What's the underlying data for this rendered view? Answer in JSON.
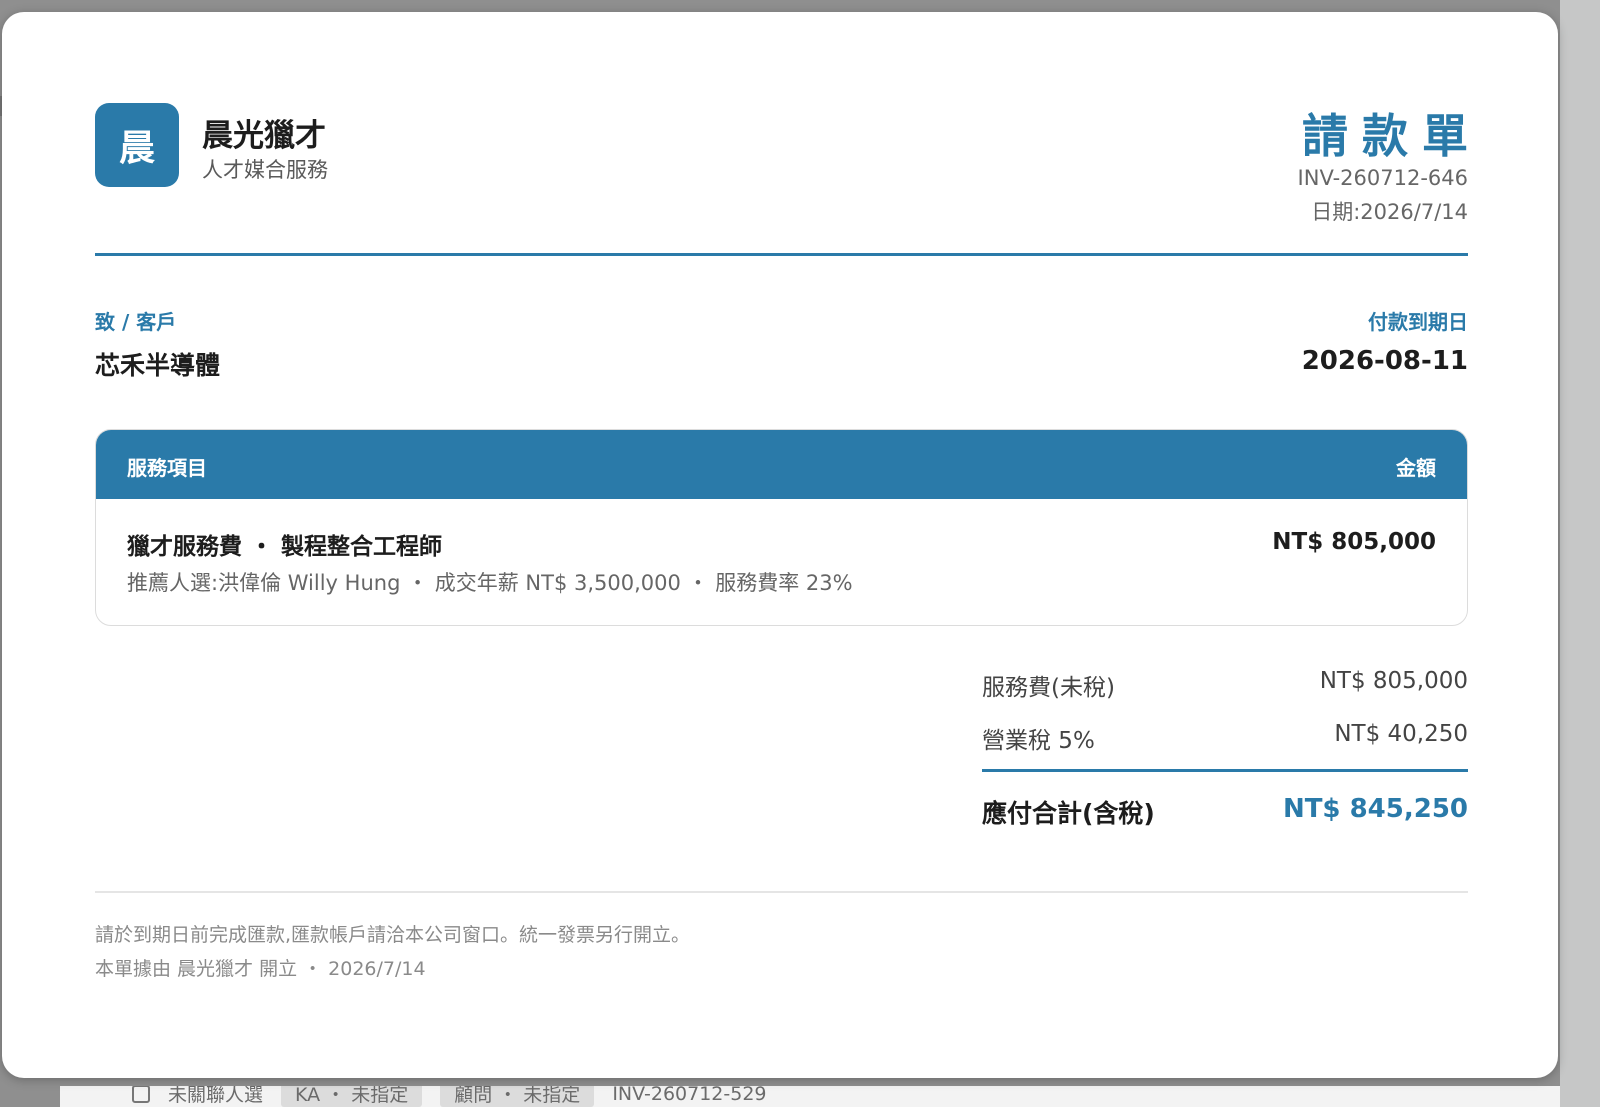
{
  "company": {
    "logo_text": "晨",
    "name": "晨光獵才",
    "subtitle": "人才媒合服務"
  },
  "document": {
    "title": "請款單",
    "number": "INV-260712-646",
    "date_line": "日期:2026/7/14"
  },
  "client": {
    "label": "致 / 客戶",
    "name": "芯禾半導體"
  },
  "due": {
    "label": "付款到期日",
    "date": "2026-08-11"
  },
  "items_table": {
    "col_item": "服務項目",
    "col_amount": "金額",
    "rows": [
      {
        "title": "獵才服務費 ・ 製程整合工程師",
        "detail": "推薦人選:洪偉倫 Willy Hung ・ 成交年薪 NT$ 3,500,000 ・ 服務費率 23%",
        "amount": "NT$ 805,000"
      }
    ]
  },
  "totals": {
    "subtotal_label": "服務費(未稅)",
    "subtotal_value": "NT$ 805,000",
    "tax_label": "營業稅 5%",
    "tax_value": "NT$ 40,250",
    "total_label": "應付合計(含稅)",
    "total_value": "NT$ 845,250"
  },
  "footer": {
    "note": "請於到期日前完成匯款,匯款帳戶請洽本公司窗口。統一發票另行開立。",
    "issued": "本單據由 晨光獵才 開立 ・ 2026/7/14"
  },
  "background_list": {
    "row_text": "未關聯人選",
    "chip_1": "KA ・ 未指定",
    "chip_2": "顧問 ・ 未指定",
    "invoice_no": "INV-260712-529"
  },
  "colors": {
    "accent": "#2a7aa9",
    "text_dark": "#1d1d1d",
    "text_muted": "#666666"
  }
}
